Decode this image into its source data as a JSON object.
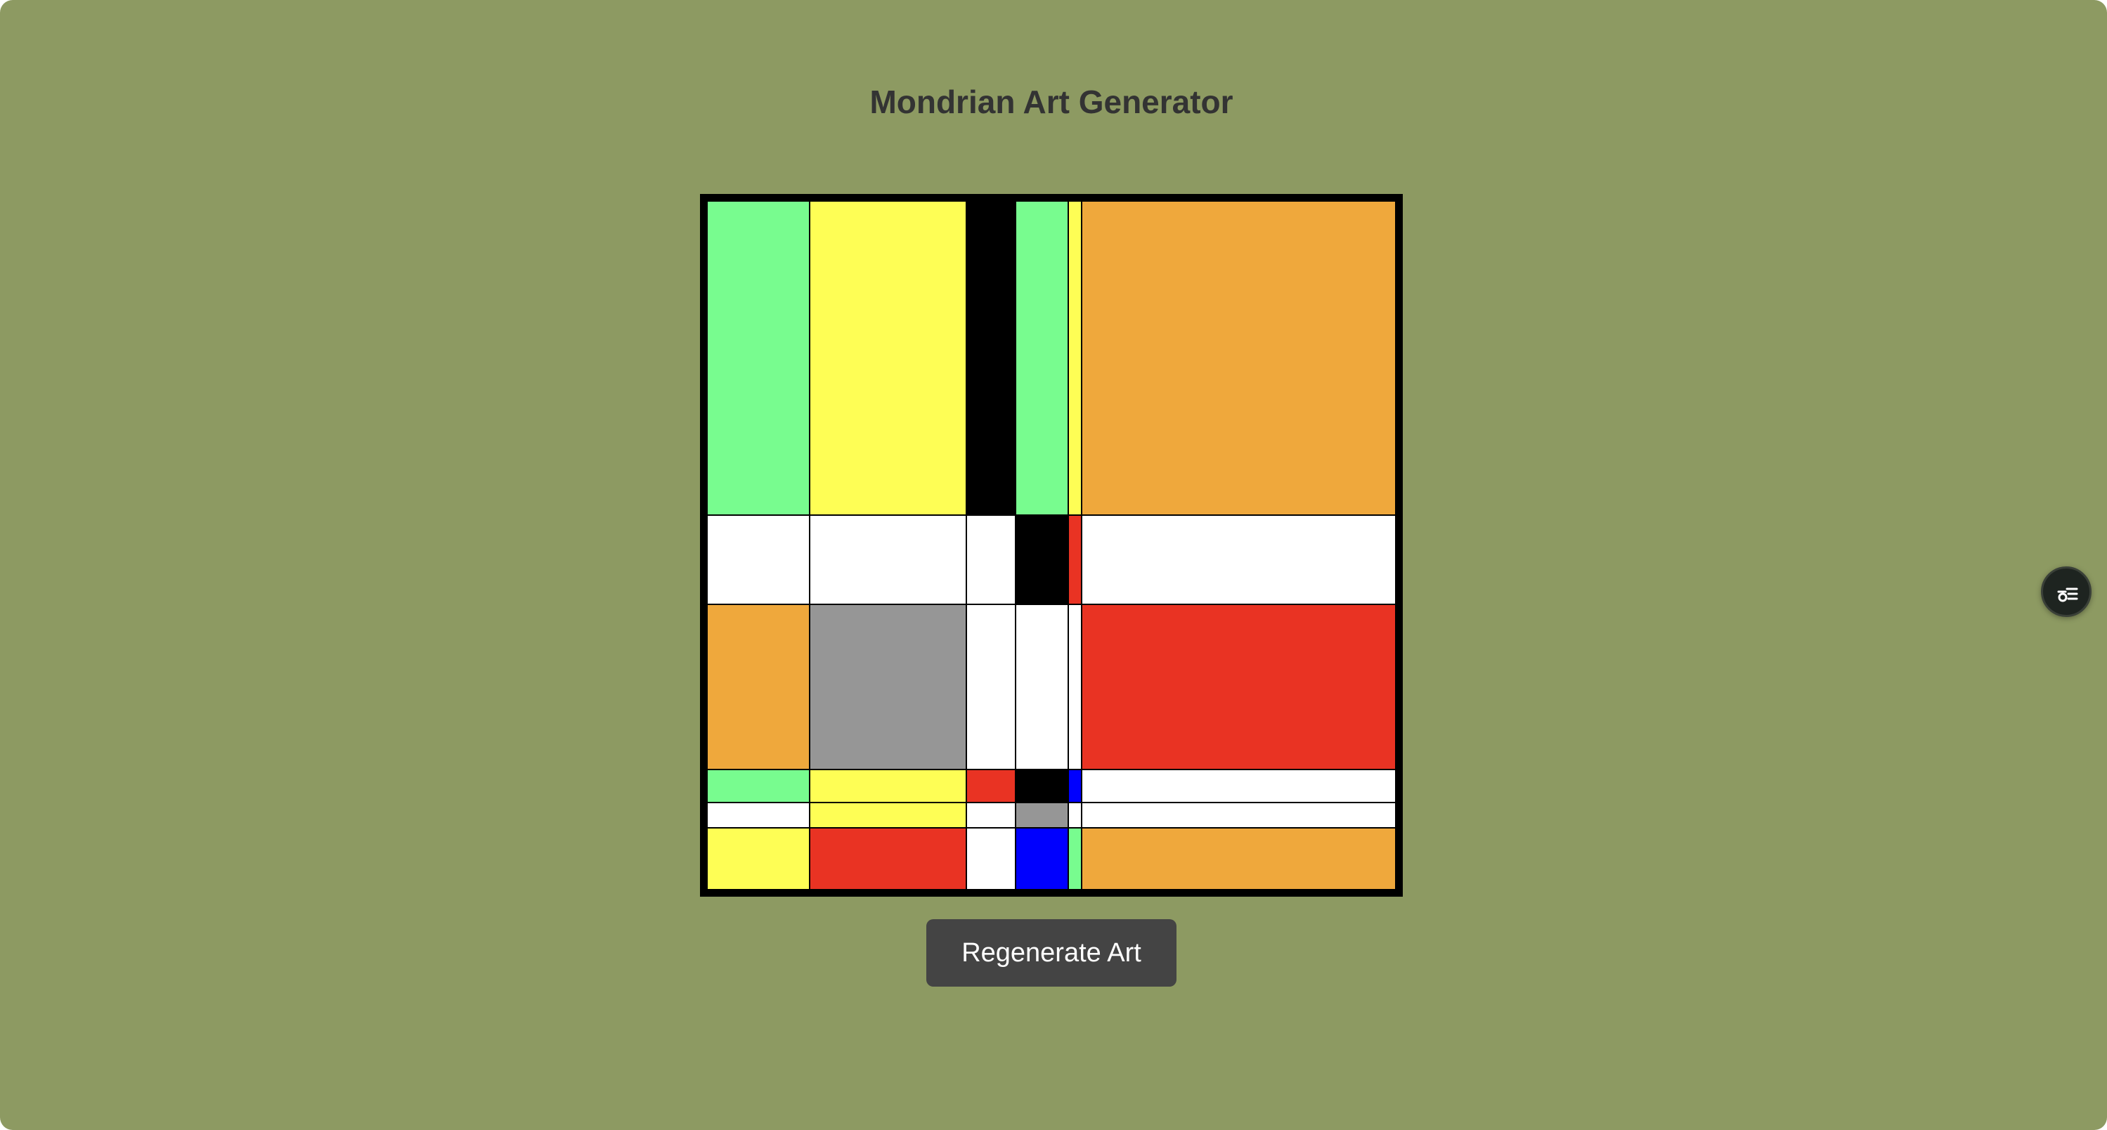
{
  "colors": {
    "background": "#8d9a62",
    "title_text": "#333333",
    "button_background": "#444444",
    "button_text": "#ffffff",
    "green": "#78fc8f",
    "yellow": "#fefe55",
    "orange": "#efa83c",
    "red": "#e93323",
    "gray": "#969696",
    "blue": "#0000fe",
    "black": "#000000",
    "white": "#ffffff"
  },
  "header": {
    "title": "Mondrian Art Generator"
  },
  "art": {
    "rows": [
      [
        "green",
        "yellow",
        "black",
        "green",
        "yellow",
        "orange"
      ],
      [
        "white",
        "white",
        "white",
        "black",
        "red",
        "white"
      ],
      [
        "orange",
        "gray",
        "white",
        "white",
        "white",
        "red"
      ],
      [
        "green",
        "yellow",
        "red",
        "black",
        "blue",
        "white"
      ],
      [
        "white",
        "yellow",
        "white",
        "gray",
        "white",
        "white"
      ],
      [
        "yellow",
        "red",
        "white",
        "blue",
        "green",
        "orange"
      ]
    ]
  },
  "actions": {
    "regenerate_label": "Regenerate Art"
  },
  "floating_button": {
    "icon": "settings-list-icon"
  }
}
